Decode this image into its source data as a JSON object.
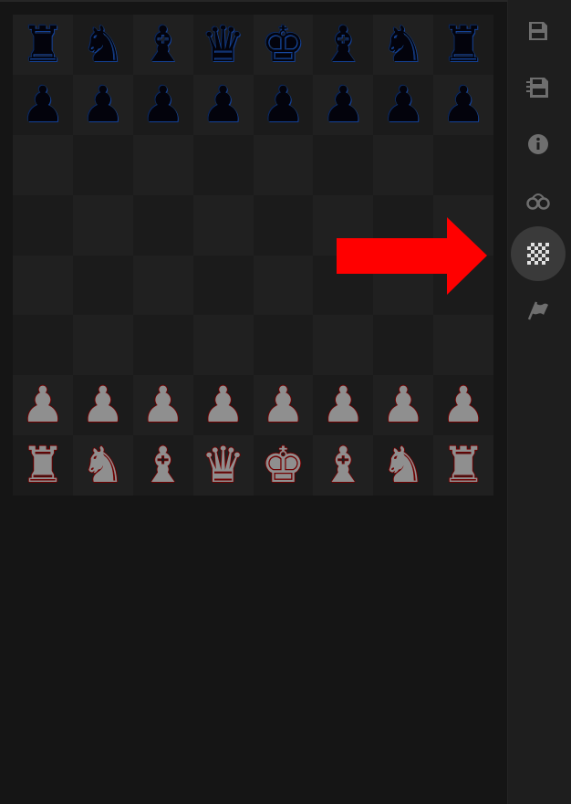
{
  "board": {
    "ranks": [
      [
        [
          "r",
          "black",
          "♜"
        ],
        [
          "n",
          "black",
          "♞"
        ],
        [
          "b",
          "black",
          "♝"
        ],
        [
          "q",
          "black",
          "♛"
        ],
        [
          "k",
          "black",
          "♚"
        ],
        [
          "b",
          "black",
          "♝"
        ],
        [
          "n",
          "black",
          "♞"
        ],
        [
          "r",
          "black",
          "♜"
        ]
      ],
      [
        [
          "p",
          "black",
          "♟"
        ],
        [
          "p",
          "black",
          "♟"
        ],
        [
          "p",
          "black",
          "♟"
        ],
        [
          "p",
          "black",
          "♟"
        ],
        [
          "p",
          "black",
          "♟"
        ],
        [
          "p",
          "black",
          "♟"
        ],
        [
          "p",
          "black",
          "♟"
        ],
        [
          "p",
          "black",
          "♟"
        ]
      ],
      [
        null,
        null,
        null,
        null,
        null,
        null,
        null,
        null
      ],
      [
        null,
        null,
        null,
        null,
        null,
        null,
        null,
        null
      ],
      [
        null,
        null,
        null,
        null,
        null,
        null,
        null,
        null
      ],
      [
        null,
        null,
        null,
        null,
        null,
        null,
        null,
        null
      ],
      [
        [
          "P",
          "white",
          "♟"
        ],
        [
          "P",
          "white",
          "♟"
        ],
        [
          "P",
          "white",
          "♟"
        ],
        [
          "P",
          "white",
          "♟"
        ],
        [
          "P",
          "white",
          "♟"
        ],
        [
          "P",
          "white",
          "♟"
        ],
        [
          "P",
          "white",
          "♟"
        ],
        [
          "P",
          "white",
          "♟"
        ]
      ],
      [
        [
          "R",
          "white",
          "♜"
        ],
        [
          "N",
          "white",
          "♞"
        ],
        [
          "B",
          "white",
          "♝"
        ],
        [
          "Q",
          "white",
          "♛"
        ],
        [
          "K",
          "white",
          "♚"
        ],
        [
          "B",
          "white",
          "♝"
        ],
        [
          "N",
          "white",
          "♞"
        ],
        [
          "R",
          "white",
          "♜"
        ]
      ]
    ],
    "colors": {
      "light_square": "#202020",
      "dark_square": "#1b1b1b",
      "black_piece": "#03030c",
      "black_outline": "#1f6fd8",
      "white_piece": "#8f8f8f",
      "white_outline": "#8a0000"
    }
  },
  "sidebar": {
    "buttons": [
      {
        "icon": "save-icon",
        "active": false
      },
      {
        "icon": "save-as-icon",
        "active": false
      },
      {
        "icon": "info-icon",
        "active": false
      },
      {
        "icon": "handcuffs-icon",
        "active": false
      },
      {
        "icon": "board-theme-icon",
        "active": true
      },
      {
        "icon": "flag-icon",
        "active": false
      }
    ],
    "icon_color": "#6e6e6e",
    "active_bg": "#3a3a3a"
  },
  "annotation": {
    "arrow_color": "#ff0000",
    "points_to": "board-theme-icon"
  }
}
